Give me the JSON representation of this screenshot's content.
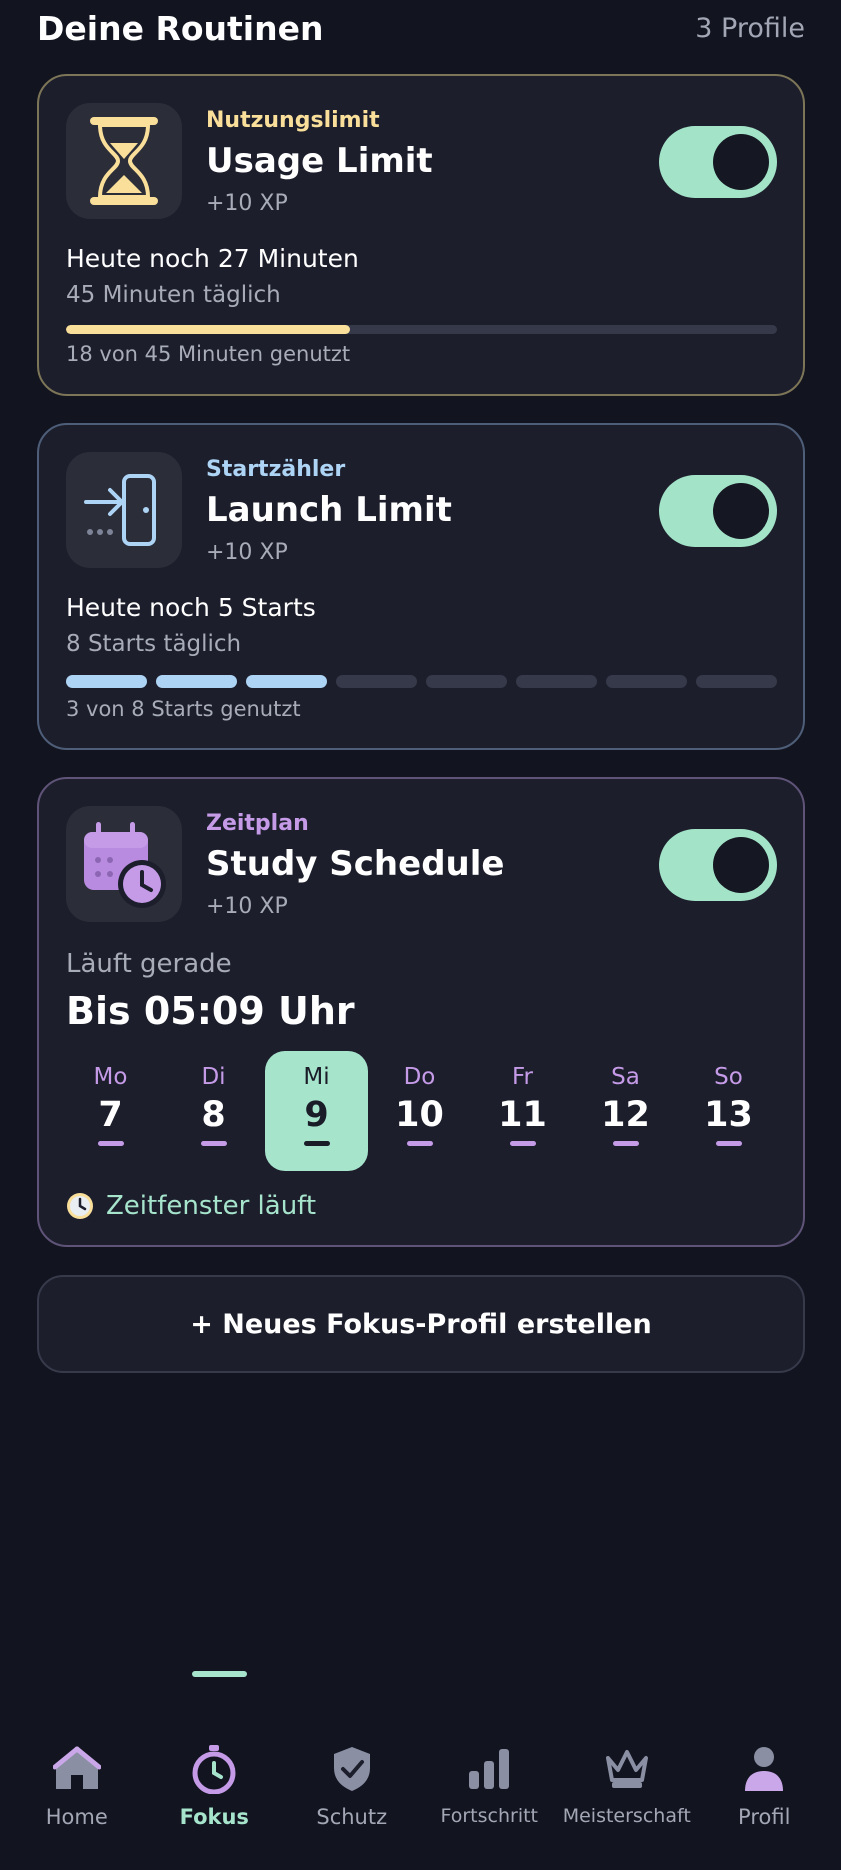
{
  "header": {
    "title": "Deine Routinen",
    "count": "3 Profile"
  },
  "colors": {
    "background": "#121420",
    "card": "#1c1e2c",
    "accent_green": "#a6e4cc",
    "usage_yellow": "#f9df9a",
    "launch_blue": "#aed4f5",
    "schedule_purple": "#c59be8"
  },
  "cards": {
    "usage": {
      "icon": "hourglass-icon",
      "type": "Nutzungslimit",
      "name": "Usage Limit",
      "xp": "+10 XP",
      "toggle_on": true,
      "remaining": "Heute noch 27 Minuten",
      "daily": "45 Minuten täglich",
      "used_fraction": 0.4,
      "footer": "18 von 45 Minuten genutzt"
    },
    "launch": {
      "icon": "door-enter-icon",
      "type": "Startzähler",
      "name": "Launch Limit",
      "xp": "+10 XP",
      "toggle_on": true,
      "remaining": "Heute noch 5 Starts",
      "daily": "8 Starts täglich",
      "used": 3,
      "total": 8,
      "footer": "3 von 8 Starts genutzt"
    },
    "schedule": {
      "icon": "calendar-clock-icon",
      "type": "Zeitplan",
      "name": "Study Schedule",
      "xp": "+10 XP",
      "toggle_on": true,
      "running_label": "Läuft gerade",
      "running_until": "Bis 05:09 Uhr",
      "days": [
        {
          "name": "Mo",
          "num": "7",
          "active": false
        },
        {
          "name": "Di",
          "num": "8",
          "active": false
        },
        {
          "name": "Mi",
          "num": "9",
          "active": true
        },
        {
          "name": "Do",
          "num": "10",
          "active": false
        },
        {
          "name": "Fr",
          "num": "11",
          "active": false
        },
        {
          "name": "Sa",
          "num": "12",
          "active": false
        },
        {
          "name": "So",
          "num": "13",
          "active": false
        }
      ],
      "status_icon": "clock-icon",
      "status": "Zeitfenster läuft"
    }
  },
  "create_button": {
    "label": "+ Neues Fokus-Profil erstellen"
  },
  "nav": [
    {
      "label": "Home",
      "icon": "home-icon",
      "active": false
    },
    {
      "label": "Fokus",
      "icon": "stopwatch-icon",
      "active": true
    },
    {
      "label": "Schutz",
      "icon": "shield-check-icon",
      "active": false
    },
    {
      "label": "Fortschritt",
      "icon": "bar-chart-icon",
      "active": false
    },
    {
      "label": "Meisterschaft",
      "icon": "crown-icon",
      "active": false
    },
    {
      "label": "Profil",
      "icon": "person-icon",
      "active": false
    }
  ]
}
